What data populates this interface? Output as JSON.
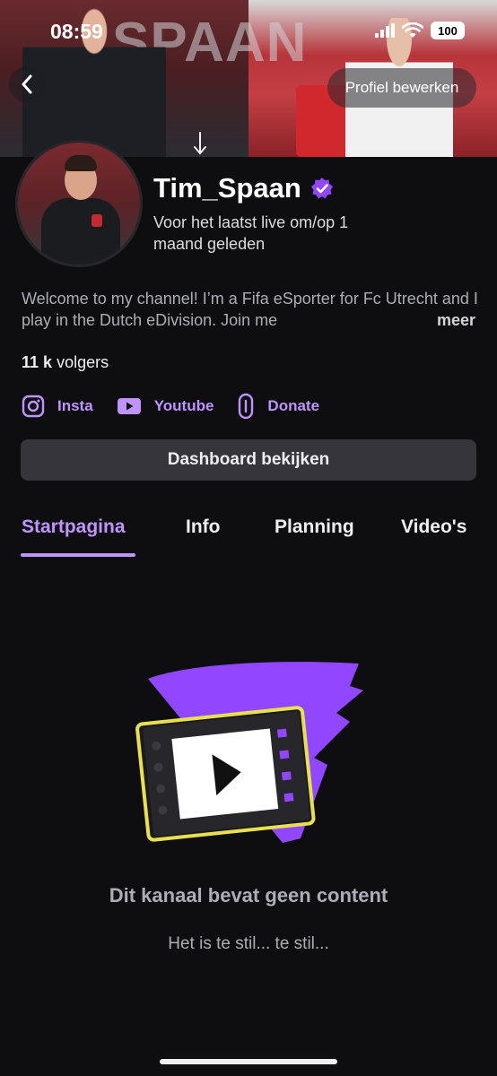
{
  "status_bar": {
    "time": "08:59",
    "battery": "100"
  },
  "banner": {
    "text": "SPAAN"
  },
  "header": {
    "edit_profile_label": "Profiel bewerken"
  },
  "profile": {
    "username": "Tim_Spaan",
    "last_live": "Voor het laatst live om/op 1 maand geleden",
    "bio": "Welcome to my channel! I’m a Fifa eSporter for Fc Utrecht and I play in the Dutch eDivision. Join me",
    "bio_more": "meer",
    "followers_count": "11 k",
    "followers_label": "volgers"
  },
  "links": [
    {
      "label": "Insta",
      "icon": "instagram-icon"
    },
    {
      "label": "Youtube",
      "icon": "youtube-icon"
    },
    {
      "label": "Donate",
      "icon": "link-icon"
    }
  ],
  "dashboard_button": "Dashboard bekijken",
  "tabs": [
    {
      "label": "Startpagina",
      "active": true
    },
    {
      "label": "Info",
      "active": false
    },
    {
      "label": "Planning",
      "active": false
    },
    {
      "label": "Video's",
      "active": false
    }
  ],
  "empty_state": {
    "title": "Dit kanaal bevat geen content",
    "subtitle": "Het is te stil... te stil..."
  },
  "colors": {
    "accent": "#bf94ff",
    "background": "#0e0e10",
    "button": "#35353b",
    "muted_text": "#adadb8"
  }
}
